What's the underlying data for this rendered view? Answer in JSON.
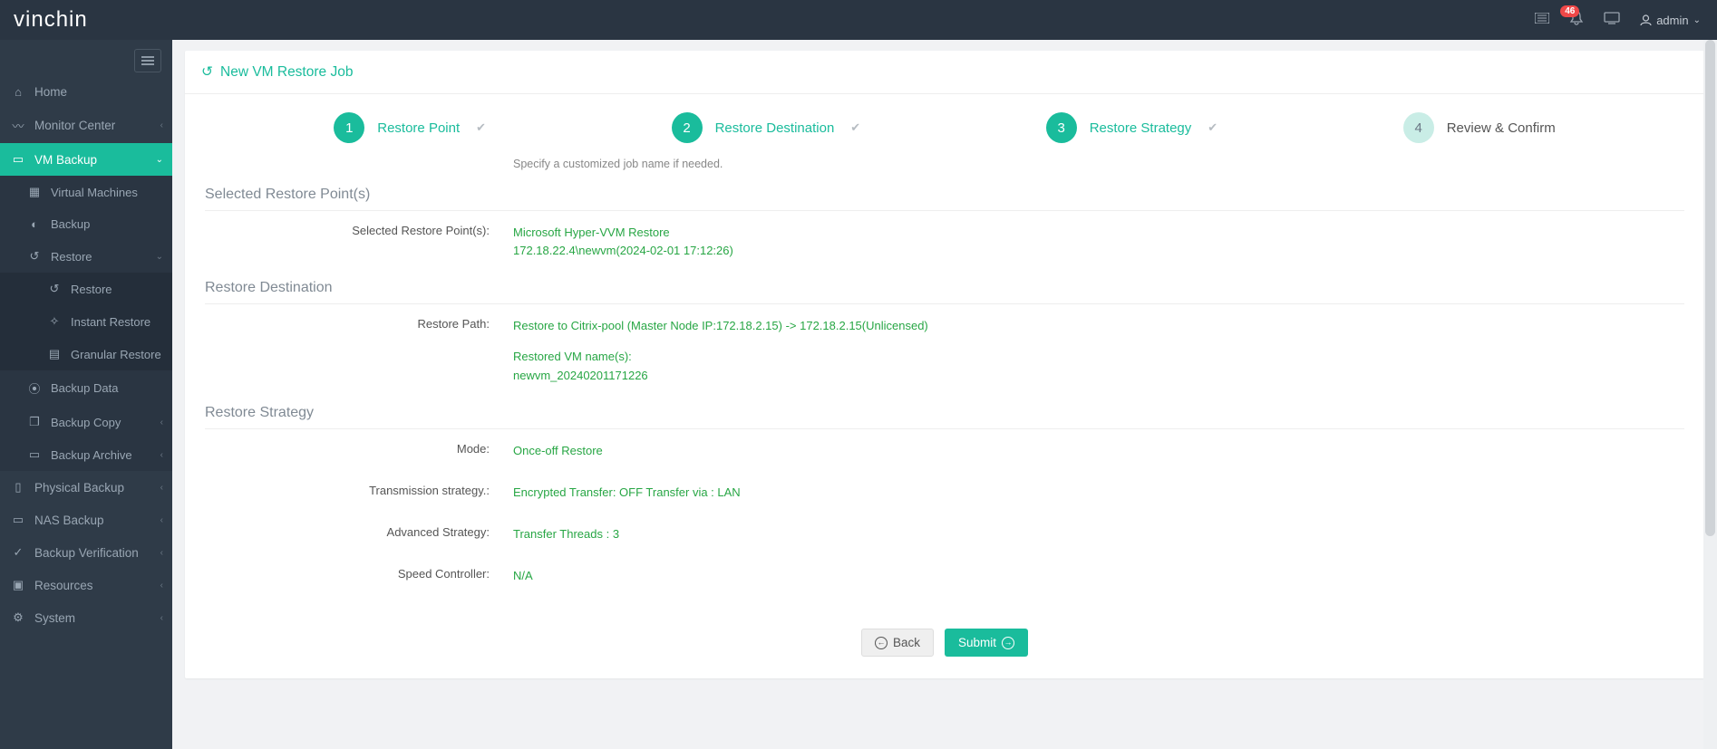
{
  "brand": {
    "left": "vin",
    "right": "chin"
  },
  "topbar": {
    "notif_count": "46",
    "user": "admin"
  },
  "sidebar": {
    "home": "Home",
    "monitor": "Monitor Center",
    "vmbackup": "VM Backup",
    "vmsub": {
      "vms": "Virtual Machines",
      "backup": "Backup",
      "restore": "Restore",
      "restore_sub": {
        "restore": "Restore",
        "instant": "Instant Restore",
        "granular": "Granular Restore"
      },
      "backup_data": "Backup Data",
      "backup_copy": "Backup Copy",
      "backup_archive": "Backup Archive"
    },
    "phys": "Physical Backup",
    "nas": "NAS Backup",
    "verify": "Backup Verification",
    "resources": "Resources",
    "system": "System"
  },
  "page": {
    "title": "New VM Restore Job",
    "steps": {
      "s1": "Restore Point",
      "s2": "Restore Destination",
      "s3": "Restore Strategy",
      "s4": "Review & Confirm"
    },
    "hint": "Specify a customized job name if needed.",
    "sec_points": {
      "title": "Selected Restore Point(s)",
      "label": "Selected Restore Point(s):",
      "v1": "Microsoft Hyper-VVM Restore",
      "v2": "172.18.22.4\\newvm(2024-02-01 17:12:26)"
    },
    "sec_dest": {
      "title": "Restore Destination",
      "label": "Restore Path:",
      "v1": "Restore to Citrix-pool (Master Node IP:172.18.2.15) -> 172.18.2.15(Unlicensed)",
      "v2": "Restored VM name(s):",
      "v3": "newvm_20240201171226"
    },
    "sec_strat": {
      "title": "Restore Strategy",
      "mode_l": "Mode:",
      "mode_v": "Once-off Restore",
      "trans_l": "Transmission strategy.:",
      "trans_v": "Encrypted Transfer: OFF Transfer via : LAN",
      "adv_l": "Advanced Strategy:",
      "adv_v": "Transfer Threads : 3",
      "speed_l": "Speed Controller:",
      "speed_v": "N/A"
    },
    "buttons": {
      "back": "Back",
      "submit": "Submit"
    }
  }
}
